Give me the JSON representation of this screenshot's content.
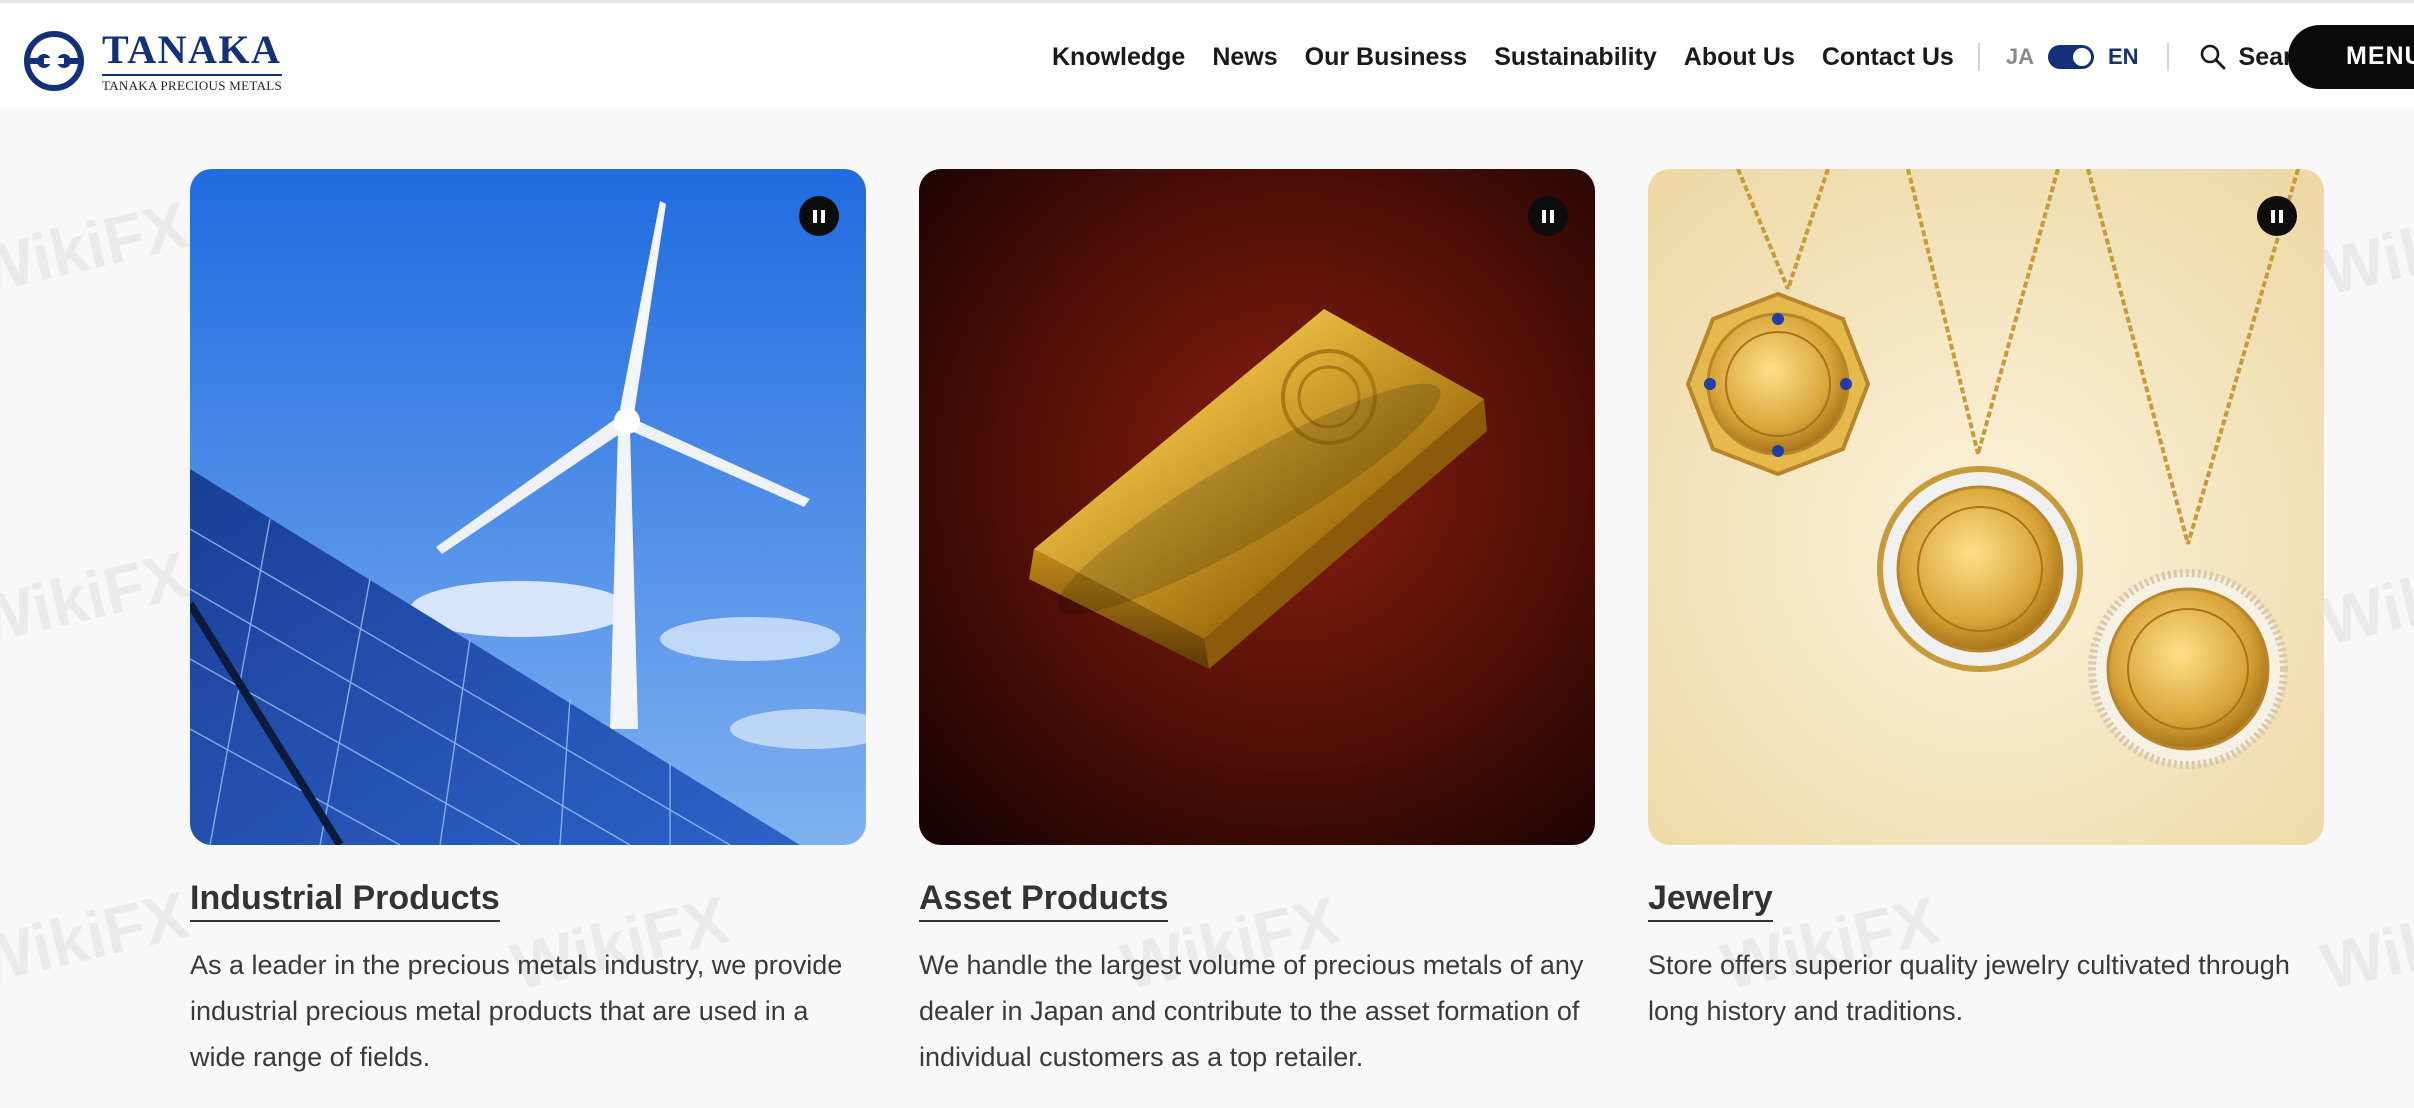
{
  "brand": {
    "name": "TANAKA",
    "subtitle": "TANAKA PRECIOUS METALS",
    "color": "#13307a"
  },
  "nav": {
    "items": [
      "Knowledge",
      "News",
      "Our Business",
      "Sustainability",
      "About Us",
      "Contact Us"
    ],
    "lang": {
      "ja": "JA",
      "en": "EN",
      "selected": "EN"
    },
    "search_label": "Search",
    "menu_label": "MENU"
  },
  "cards": [
    {
      "title": "Industrial Products",
      "description": "As a leader in the precious metals industry, we provide industrial precious metal products that are used in a wide range of fields.",
      "image": "wind-turbine-solar-panels"
    },
    {
      "title": "Asset Products",
      "description": "We handle the largest volume of precious metals of any dealer in Japan and contribute to the asset formation of individual customers as a top retailer.",
      "image": "gold-bar"
    },
    {
      "title": "Jewelry",
      "description": "Store offers superior quality jewelry cultivated through long history and traditions.",
      "image": "gold-coin-pendants"
    }
  ],
  "watermark": "WikiFX",
  "colors": {
    "accent": "#13307a",
    "page_bg": "#f8f8f8",
    "menu_bg": "#0b0b0b"
  }
}
